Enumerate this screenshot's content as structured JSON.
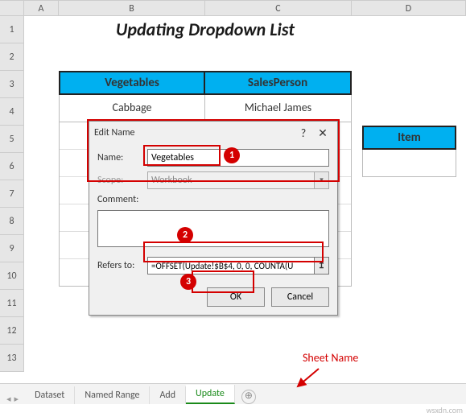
{
  "columns": {
    "A": "A",
    "B": "B",
    "C": "C",
    "D": "D"
  },
  "rows": [
    "1",
    "2",
    "3",
    "4",
    "5",
    "6",
    "7",
    "8",
    "9",
    "10",
    "11",
    "12",
    "13"
  ],
  "title": "Updating Dropdown List",
  "headers": {
    "veg": "Vegetables",
    "sp": "SalesPerson",
    "item": "Item"
  },
  "data_row": {
    "veg": "Cabbage",
    "sp": "Michael James"
  },
  "dialog": {
    "title": "Edit Name",
    "help": "?",
    "close": "✕",
    "labels": {
      "name": "Name:",
      "scope": "Scope:",
      "comment": "Comment:",
      "refers": "Refers to:"
    },
    "name_value": "Vegetables",
    "scope_value": "Workbook",
    "comment_value": "",
    "refers_value": "=OFFSET(Update!$B$4, 0, 0, COUNTA(U",
    "collapse_glyph": "↥",
    "ok": "OK",
    "cancel": "Cancel"
  },
  "callouts": {
    "c1": "1",
    "c2": "2",
    "c3": "3"
  },
  "annotation": "Sheet Name",
  "tabs": {
    "nav_left": "◂",
    "nav_right": "▸",
    "items": [
      "Dataset",
      "Named Range",
      "Add",
      "Update"
    ],
    "active": "Update",
    "add_glyph": "⊕"
  },
  "watermark": "wsxdn.com"
}
